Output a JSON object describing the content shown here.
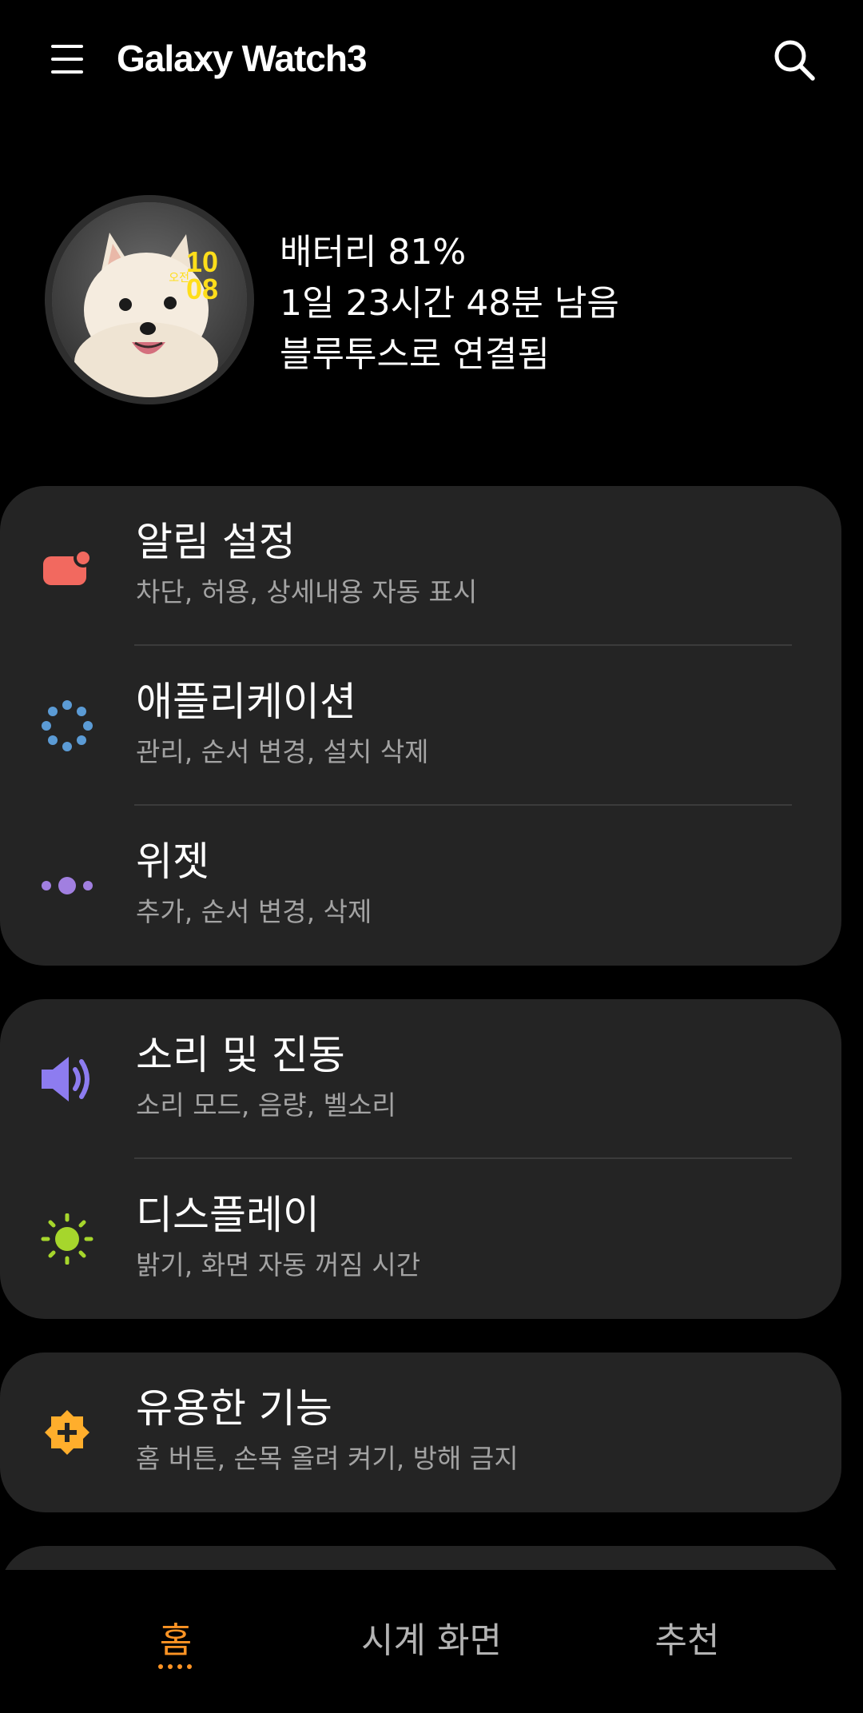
{
  "header": {
    "title": "Galaxy Watch3",
    "menu_icon": "hamburger-menu-icon",
    "search_icon": "search-icon"
  },
  "device": {
    "watch_ampm": "오전",
    "watch_hour": "10",
    "watch_minute": "08",
    "battery": "배터리 81%",
    "remaining": "1일 23시간 48분 남음",
    "connection": "블루투스로 연결됨"
  },
  "sections": {
    "notifications": {
      "title": "알림 설정",
      "subtitle": "차단, 허용, 상세내용 자동 표시",
      "icon": "notification-icon",
      "color": "#f2695f"
    },
    "apps": {
      "title": "애플리케이션",
      "subtitle": "관리, 순서 변경, 설치 삭제",
      "icon": "apps-icon",
      "color": "#5b9bd5"
    },
    "widgets": {
      "title": "위젯",
      "subtitle": "추가, 순서 변경, 삭제",
      "icon": "widgets-icon",
      "color": "#a17fe0"
    },
    "sound": {
      "title": "소리 및 진동",
      "subtitle": "소리 모드, 음량, 벨소리",
      "icon": "volume-icon",
      "color": "#8d7cf0"
    },
    "display": {
      "title": "디스플레이",
      "subtitle": "밝기, 화면 자동 꺼짐 시간",
      "icon": "brightness-icon",
      "color": "#a6d62c"
    },
    "advanced": {
      "title": "유용한 기능",
      "subtitle": "홈 버튼, 손목 올려 켜기, 방해 금지",
      "icon": "advanced-features-icon",
      "color": "#ffae2c"
    }
  },
  "bottom_nav": {
    "home": "홈",
    "watch_faces": "시계 화면",
    "recommended": "추천",
    "active_color": "#ff9424"
  }
}
